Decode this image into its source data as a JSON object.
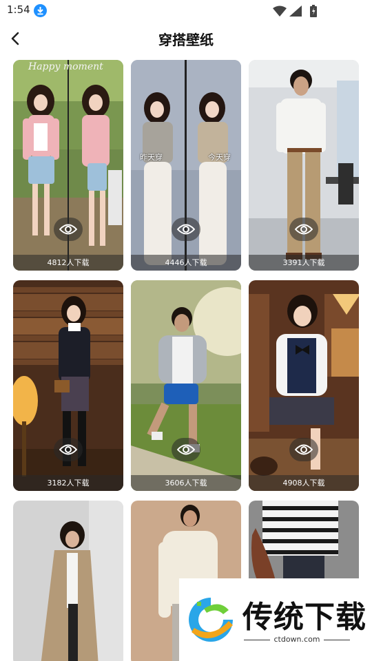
{
  "status": {
    "time": "1:54"
  },
  "header": {
    "title": "穿搭壁纸"
  },
  "cards": [
    {
      "downloads": "4812人下载",
      "overlay_left": "Happy moment",
      "caption_left": "",
      "caption_right": ""
    },
    {
      "downloads": "4446人下载",
      "caption_left": "昨天穿",
      "caption_right": "今天穿"
    },
    {
      "downloads": "3391人下载"
    },
    {
      "downloads": "3182人下载"
    },
    {
      "downloads": "3606人下载"
    },
    {
      "downloads": "4908人下载"
    },
    {
      "downloads": ""
    },
    {
      "downloads": ""
    },
    {
      "downloads": ""
    }
  ],
  "watermark": {
    "title": "传统下载",
    "url": "ctdown.com"
  },
  "colors": {
    "accent": "#1e90ff",
    "overlay": "#282828"
  }
}
